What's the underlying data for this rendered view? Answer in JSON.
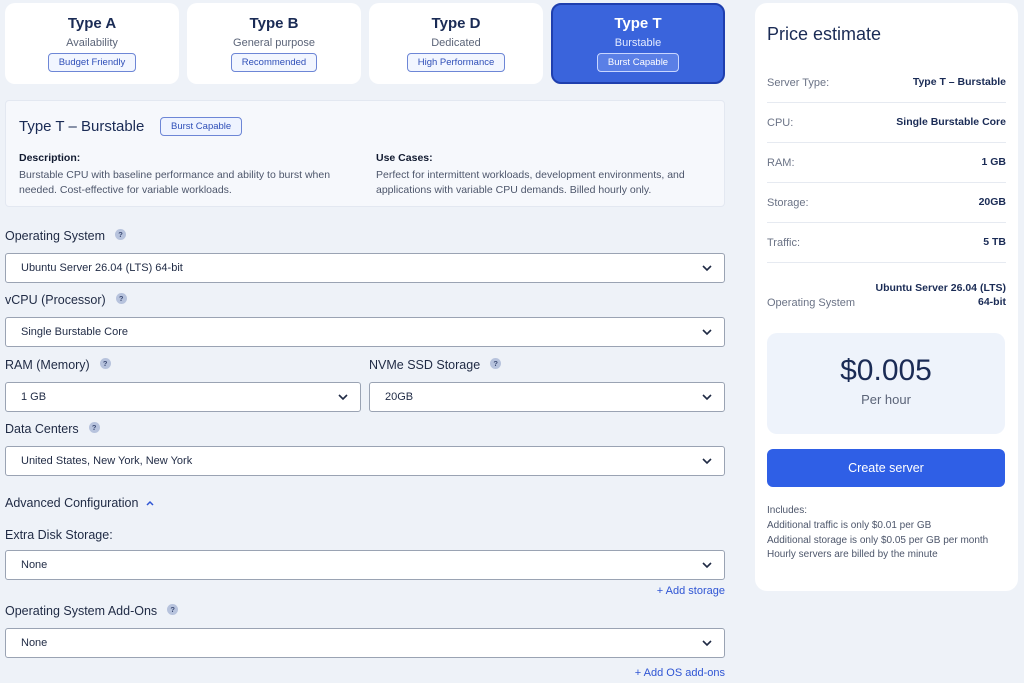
{
  "types": [
    {
      "title": "Type A",
      "subtitle": "Availability",
      "badge": "Budget Friendly"
    },
    {
      "title": "Type B",
      "subtitle": "General purpose",
      "badge": "Recommended"
    },
    {
      "title": "Type D",
      "subtitle": "Dedicated",
      "badge": "High Performance"
    },
    {
      "title": "Type T",
      "subtitle": "Burstable",
      "badge": "Burst Capable"
    }
  ],
  "info": {
    "title": "Type T – Burstable",
    "badge": "Burst Capable",
    "description_heading": "Description:",
    "description_line1": "Burstable CPU with baseline performance and ability to burst when",
    "description_line2": "needed. Cost-effective for variable workloads.",
    "usecases_heading": "Use Cases:",
    "usecases_line1": "Perfect for intermittent workloads, development environments, and",
    "usecases_line2": "applications with variable CPU demands. Billed hourly only."
  },
  "form": {
    "os_label": "Operating System",
    "os_value": "Ubuntu Server 26.04 (LTS) 64-bit",
    "vcpu_label": "vCPU (Processor)",
    "vcpu_value": "Single Burstable Core",
    "ram_label": "RAM (Memory)",
    "ram_value": "1 GB",
    "storage_label": "NVMe SSD Storage",
    "storage_value": "20GB",
    "dc_label": "Data Centers",
    "dc_value": "United States, New York, New York",
    "advanced_label": "Advanced Configuration",
    "extra_disk_label": "Extra Disk Storage:",
    "extra_disk_value": "None",
    "add_storage": "+ Add storage",
    "os_addons_label": "Operating System Add-Ons",
    "os_addons_value": "None",
    "add_os_addons": "+ Add OS add-ons",
    "help_glyph": "?"
  },
  "price": {
    "title": "Price estimate",
    "server_type_label": "Server Type:",
    "server_type_value": "Type T – Burstable",
    "cpu_label": "CPU:",
    "cpu_value": "Single Burstable Core",
    "ram_label": "RAM:",
    "ram_value": "1 GB",
    "storage_label": "Storage:",
    "storage_value": "20GB",
    "traffic_label": "Traffic:",
    "traffic_value": "5 TB",
    "os_label": "Operating System",
    "os_value_line1": "Ubuntu Server 26.04 (LTS)",
    "os_value_line2": "64-bit",
    "amount": "$0.005",
    "per": "Per hour",
    "create_button": "Create server",
    "includes_heading": "Includes:",
    "includes": [
      "Additional traffic is only $0.01 per GB",
      "Additional storage is only $0.05 per GB per month",
      "Hourly servers are billed by the minute"
    ]
  },
  "colors": {
    "accent": "#3a64dc",
    "button": "#2f5fe6",
    "link": "#2f55d4"
  }
}
